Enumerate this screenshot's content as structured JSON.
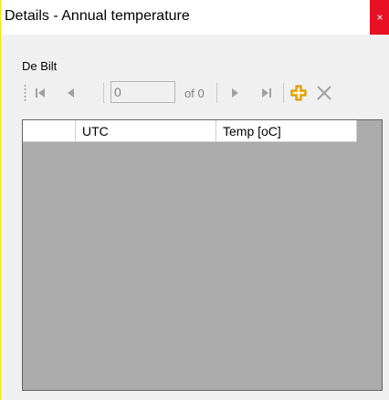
{
  "window": {
    "title": "Details - Annual temperature",
    "close_label": "×"
  },
  "group": {
    "label": "De Bilt"
  },
  "navigator": {
    "position_value": "0",
    "count_text": "of 0",
    "icons": [
      "move-first-icon",
      "move-previous-icon",
      "move-next-icon",
      "move-last-icon",
      "add-icon",
      "delete-icon"
    ]
  },
  "grid": {
    "columns": [
      "",
      "UTC",
      "Temp [oC]"
    ],
    "rows": []
  },
  "colors": {
    "close_button": "#e81123",
    "add_icon": "#f5b400",
    "grid_background": "#ababab"
  }
}
